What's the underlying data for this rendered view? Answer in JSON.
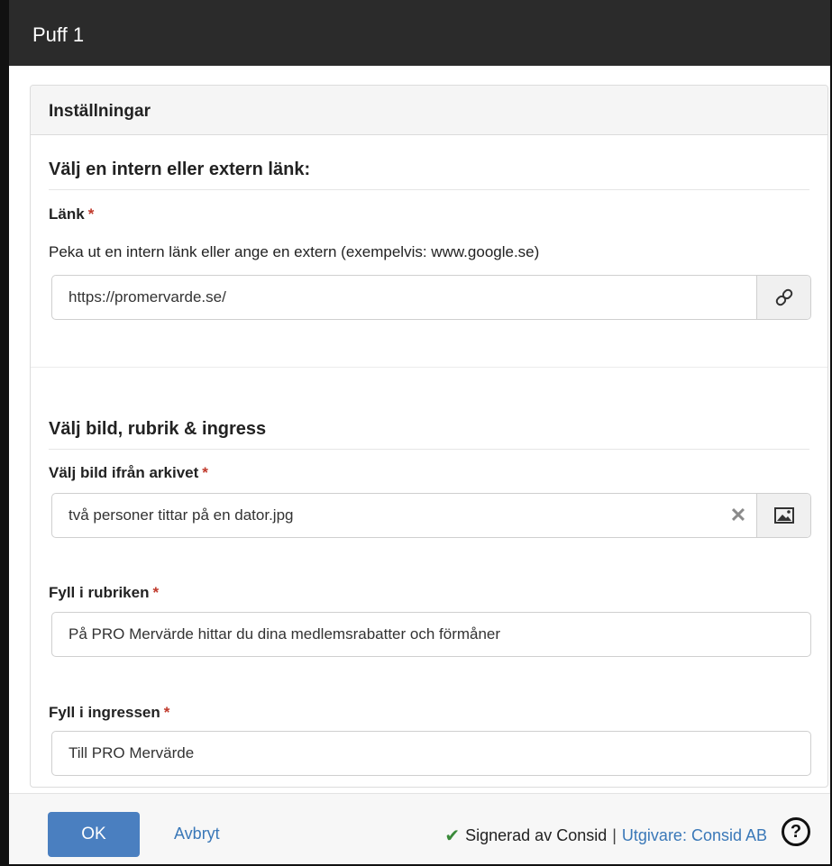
{
  "window": {
    "title": "Puff 1"
  },
  "panel": {
    "header": "Inställningar",
    "link_section": {
      "title": "Välj en intern eller extern länk:",
      "link_label": "Länk",
      "required_mark": "*",
      "help_text": "Peka ut en intern länk eller ange en extern (exempelvis: www.google.se)",
      "link_value": "https://promervarde.se/",
      "link_icon": "link-icon"
    },
    "image_section": {
      "title": "Välj bild, rubrik & ingress",
      "image_label": "Välj bild ifrån arkivet",
      "image_value": "två personer tittar på en dator.jpg",
      "clear_symbol": "✕",
      "image_icon": "image-icon",
      "heading_label": "Fyll i rubriken",
      "heading_value": "På PRO Mervärde hittar du dina medlemsrabatter och förmåner",
      "ingress_label": "Fyll i ingressen",
      "ingress_value": "Till PRO Mervärde"
    }
  },
  "footer": {
    "ok_label": "OK",
    "cancel_label": "Avbryt",
    "check_symbol": "✔",
    "signed_text": "Signerad av Consid",
    "separator": "|",
    "publisher_text": "Utgivare: Consid AB",
    "help_symbol": "?"
  },
  "colors": {
    "titlebar": "#2b2b2b",
    "primary_button": "#4a7fc0",
    "link": "#3a78b8",
    "required": "#c0392b",
    "check": "#3a8a3a"
  }
}
